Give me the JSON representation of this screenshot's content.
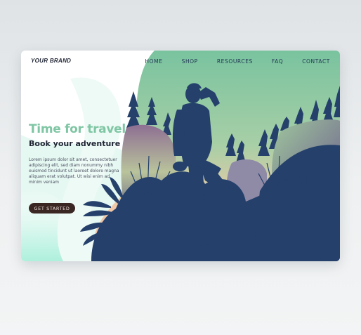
{
  "header": {
    "brand": "YOUR BRAND",
    "nav": [
      "HOME",
      "SHOP",
      "RESOURCES",
      "FAQ",
      "CONTACT"
    ]
  },
  "hero": {
    "title": "Time for travel",
    "subtitle": "Book your adventure",
    "body": "Lorem ipsum dolor sit amet, consectetuer adipiscing elit, sed diam nonummy nibh euismod tincidunt ut laoreet dolore magna aliquam erat volutpat. Ut wisi enim ad minim veniam",
    "cta_label": "GET STARTED"
  },
  "colors": {
    "accent_green": "#7fc6a4",
    "navy_silhouette": "#24406b",
    "cta_background": "#3a2623",
    "mint_wave": "#b9f0e0"
  },
  "icons": [
    "hiker-illustration",
    "pine-tree",
    "fern-leaf"
  ]
}
